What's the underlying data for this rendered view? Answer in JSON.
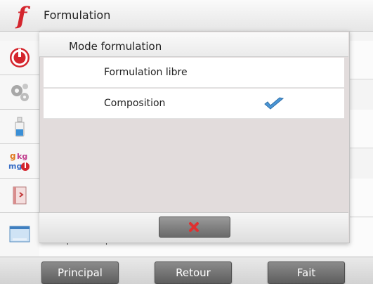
{
  "header": {
    "title": "Formulation",
    "logo_icon": "formulation-f-icon"
  },
  "sidebar": {
    "items": [
      {
        "icon": "power-icon"
      },
      {
        "icon": "gears-icon"
      },
      {
        "icon": "bottle-icon"
      },
      {
        "icon": "units-icon"
      },
      {
        "icon": "book-icon"
      },
      {
        "icon": "screen-icon"
      }
    ]
  },
  "background_list": {
    "partial_item": "Imprimer options"
  },
  "modal": {
    "title": "Mode formulation",
    "options": [
      {
        "label": "Formulation libre",
        "selected": false
      },
      {
        "label": "Composition",
        "selected": true
      }
    ],
    "cancel_icon": "close-icon"
  },
  "toolbar": {
    "principal_label": "Principal",
    "retour_label": "Retour",
    "fait_label": "Fait"
  },
  "colors": {
    "accent_red": "#d4252d",
    "check_blue": "#3f8fd0"
  }
}
